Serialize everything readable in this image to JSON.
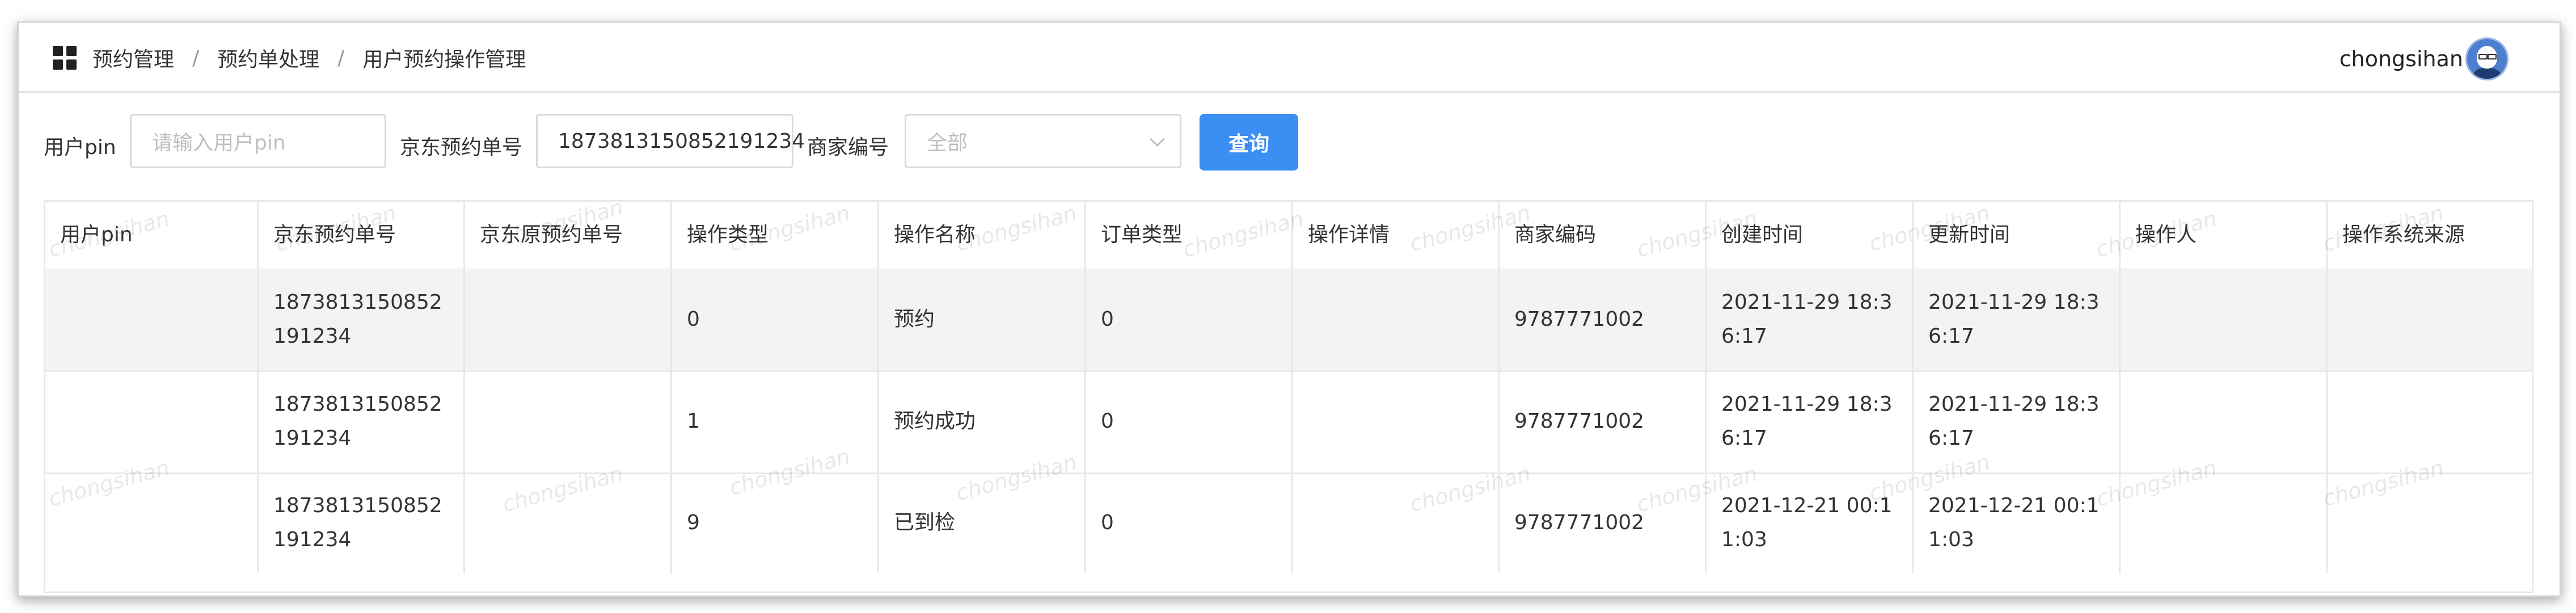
{
  "breadcrumb": [
    "预约管理",
    "预约单处理",
    "用户预约操作管理"
  ],
  "user": {
    "name": "chongsihan"
  },
  "filters": {
    "user_pin_label": "用户pin",
    "user_pin_placeholder": "请输入用户pin",
    "order_no_label": "京东预约单号",
    "order_no_value": "1873813150852191234",
    "merchant_label": "商家编号",
    "merchant_value": "全部",
    "query_label": "查询"
  },
  "table": {
    "columns": [
      "用户pin",
      "京东预约单号",
      "京东原预约单号",
      "操作类型",
      "操作名称",
      "订单类型",
      "操作详情",
      "商家编码",
      "创建时间",
      "更新时间",
      "操作人",
      "操作系统来源"
    ],
    "rows": [
      [
        "",
        "1873813150852191234",
        "",
        "0",
        "预约",
        "0",
        "",
        "9787771002",
        "2021-11-29 18:36:17",
        "2021-11-29 18:36:17",
        "",
        ""
      ],
      [
        "",
        "1873813150852191234",
        "",
        "1",
        "预约成功",
        "0",
        "",
        "9787771002",
        "2021-11-29 18:36:17",
        "2021-11-29 18:36:17",
        "",
        ""
      ],
      [
        "",
        "1873813150852191234",
        "",
        "9",
        "已到检",
        "0",
        "",
        "9787771002",
        "2021-12-21 00:11:03",
        "2021-12-21 00:11:03",
        "",
        ""
      ]
    ]
  },
  "watermark": "chongsihan",
  "colors": {
    "primary": "#3b8ff3",
    "row_hover": "#f2f3f5"
  },
  "icons": {
    "menu": "grid-icon",
    "avatar": "avatar",
    "select": "chevron-down-icon"
  }
}
